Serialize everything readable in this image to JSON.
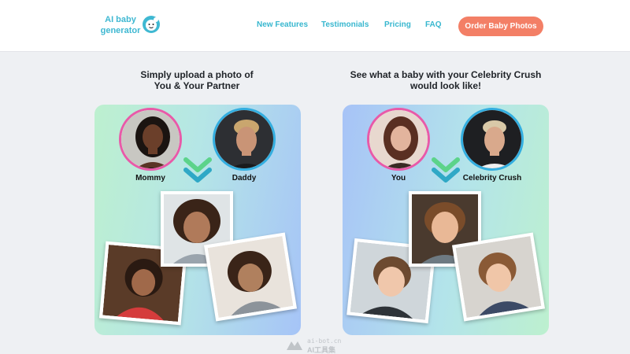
{
  "header": {
    "logo_line1": "AI baby",
    "logo_line2": "generator",
    "nav": [
      "New Features",
      "Testimonials",
      "Pricing",
      "FAQ"
    ],
    "cta_label": "Order Baby Photos"
  },
  "colors": {
    "accent_teal": "#38b7cf",
    "cta_coral": "#f37f66",
    "ring_pink": "#e85aa8",
    "ring_blue": "#33aee0",
    "chevron_green": "#5cd38a",
    "chevron_teal": "#2fa8c6"
  },
  "sections": [
    {
      "title_line1": "Simply upload a photo of",
      "title_line2": "You & Your Partner",
      "parent1_label": "Mommy",
      "parent2_label": "Daddy"
    },
    {
      "title_line1": "See what a baby with your Celebrity Crush",
      "title_line2": "would look like!",
      "parent1_label": "You",
      "parent2_label": "Celebrity Crush"
    }
  ],
  "watermark": {
    "line1": "ai-bot.cn",
    "line2": "AI工具集"
  }
}
